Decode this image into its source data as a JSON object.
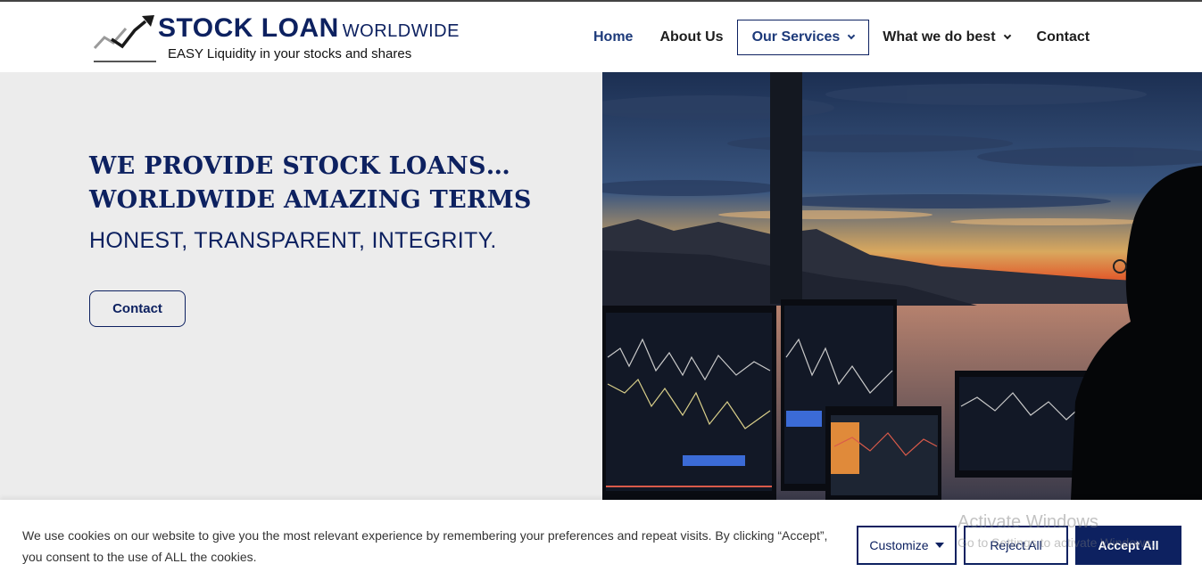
{
  "header": {
    "brand_main": "STOCK LOAN",
    "brand_sub": "WORLDWIDE",
    "tagline": "EASY Liquidity in your stocks and shares",
    "nav": [
      {
        "label": "Home"
      },
      {
        "label": "About Us"
      },
      {
        "label": "Our Services"
      },
      {
        "label": "What we do best"
      },
      {
        "label": "Contact"
      }
    ]
  },
  "hero": {
    "headline_line1": "WE PROVIDE STOCK LOANS…",
    "headline_line2": "WORLDWIDE AMAZING TERMS",
    "subheadline": "HONEST, TRANSPARENT, INTEGRITY.",
    "cta_label": "Contact"
  },
  "cookie": {
    "text": "We use cookies on our website to give you the most relevant experience by remembering your preferences and repeat visits. By clicking “Accept”, you consent to the use of ALL the cookies.",
    "customize_label": "Customize",
    "reject_label": "Reject All",
    "accept_label": "Accept All"
  },
  "os_watermark": {
    "title": "Activate Windows",
    "subtitle": "Go to Settings to activate Windows."
  },
  "colors": {
    "brand_navy": "#0d2160",
    "hero_bg": "#ececec"
  }
}
